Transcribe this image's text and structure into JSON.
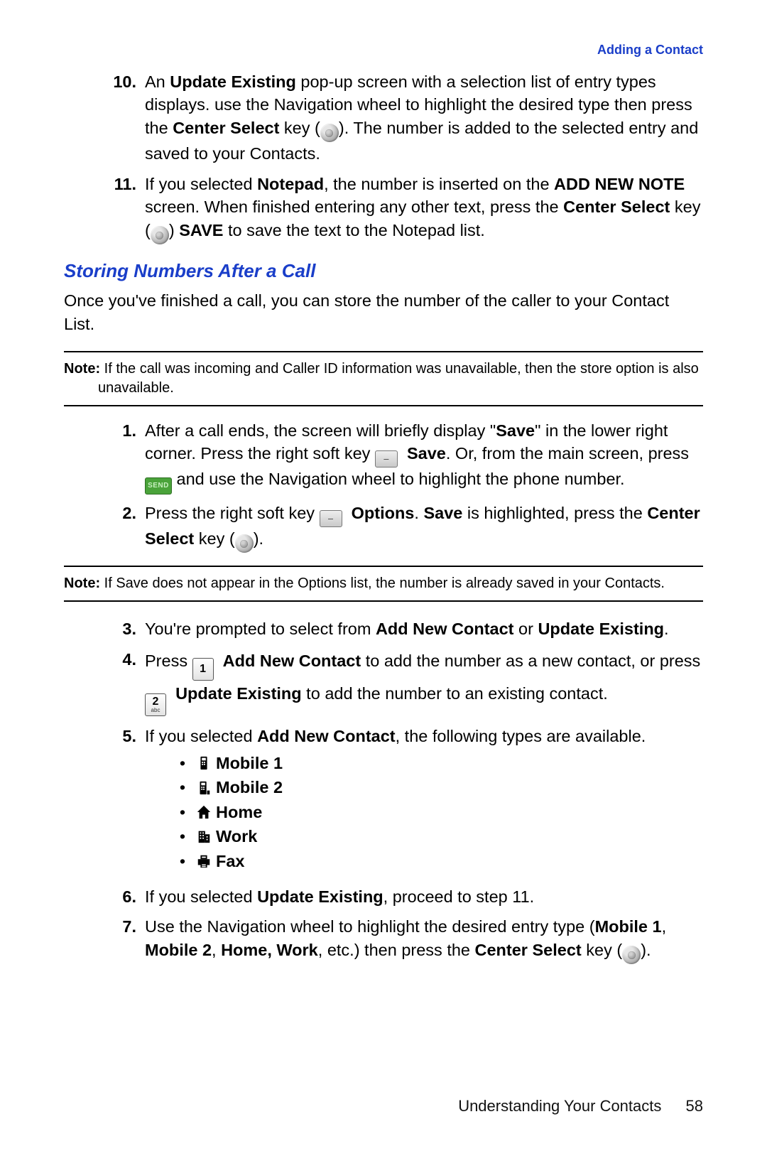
{
  "header": {
    "breadcrumb": "Adding a Contact"
  },
  "top_list": {
    "item10": {
      "num": "10.",
      "t1": "An ",
      "b1": "Update Existing",
      "t2": " pop-up screen with a selection list of entry types displays. use the Navigation wheel to highlight the desired type then press the ",
      "b2": "Center Select",
      "t3": " key (",
      "t4": "). The number is added to the selected entry and saved to your Contacts."
    },
    "item11": {
      "num": "11.",
      "t1": "If you selected ",
      "b1": "Notepad",
      "t2": ", the number is inserted on the ",
      "b2": "ADD NEW NOTE",
      "t3": " screen.  When finished entering any other text, press the ",
      "b3": "Center Select",
      "t4": " key (",
      "t5": ") ",
      "b4": "SAVE",
      "t6": " to save the text to the Notepad list."
    }
  },
  "section_heading": "Storing Numbers After a Call",
  "intro": "Once you've finished a call, you can store the number of the caller to your Contact List.",
  "note1": {
    "label": "Note:",
    "body": " If the call was incoming and Caller ID information was unavailable, then the store option is also unavailable."
  },
  "mid_list": {
    "item1": {
      "num": "1.",
      "t1": "After a call ends, the screen will briefly display \"",
      "b1": "Save",
      "t2": "\" in the lower right corner.  Press the right soft key ",
      "b2": "Save",
      "t3": ".  Or, from the main screen, press ",
      "send_label": "SEND",
      "t4": " and use the Navigation wheel to highlight the phone number."
    },
    "item2": {
      "num": "2.",
      "t1": "Press the right soft key ",
      "b1": "Options",
      "t2": ". ",
      "b2": "Save",
      "t3": " is highlighted, press the ",
      "b3": "Center Select",
      "t4": " key (",
      "t5": ")."
    }
  },
  "note2": {
    "label": "Note:",
    "body": " If Save does not appear in the Options list, the number is already saved in your Contacts."
  },
  "low_list": {
    "item3": {
      "num": "3.",
      "t1": "You're prompted to select from ",
      "b1": "Add New Contact",
      "t2": " or ",
      "b2": "Update Existing",
      "t3": "."
    },
    "item4": {
      "num": "4.",
      "t1": "Press ",
      "key1_big": "1",
      "key1_sub": "",
      "b1": "Add New Contact",
      "t2": " to add the number as a new contact, or press ",
      "key2_big": "2",
      "key2_sub": "abc",
      "b2": "Update Existing",
      "t3": " to add the number to an existing contact."
    },
    "item5": {
      "num": "5.",
      "t1": "If you selected ",
      "b1": "Add New Contact",
      "t2": ", the following types are available."
    },
    "types": [
      {
        "label": "Mobile 1",
        "icon": "mobile1-icon"
      },
      {
        "label": "Mobile 2",
        "icon": "mobile2-icon"
      },
      {
        "label": "Home",
        "icon": "home-icon"
      },
      {
        "label": "Work",
        "icon": "work-icon"
      },
      {
        "label": "Fax",
        "icon": "fax-icon"
      }
    ],
    "item6": {
      "num": "6.",
      "t1": "If you selected ",
      "b1": "Update Existing",
      "t2": ", proceed to step 11."
    },
    "item7": {
      "num": "7.",
      "t1": "Use the Navigation wheel to highlight the desired entry type (",
      "b1": "Mobile 1",
      "t2": ", ",
      "b2": "Mobile 2",
      "t3": ", ",
      "b3": "Home, Work",
      "t4": ", etc.) then press the ",
      "b4": "Center Select",
      "t5": " key (",
      "t6": ")."
    }
  },
  "footer": {
    "section": "Understanding Your Contacts",
    "page": "58"
  }
}
